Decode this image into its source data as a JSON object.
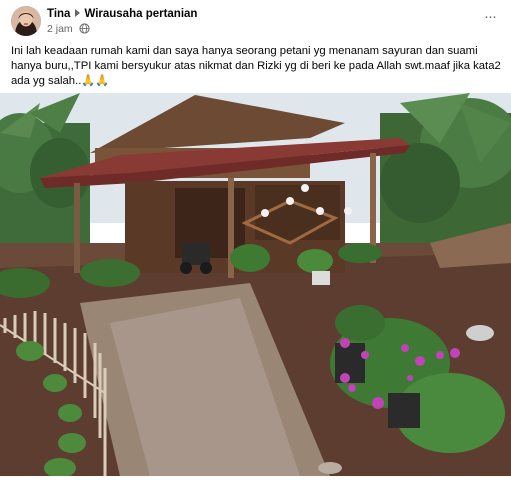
{
  "post": {
    "author": "Tina",
    "group": "Wirausaha pertanian",
    "timestamp": "2 jam",
    "audience_icon": "globe-icon",
    "more_icon": "more-options-icon",
    "more_label": "···",
    "caption_line1": "Ini lah keadaan rumah kami dan saya hanya seorang petani yg menanam sayuran dan suami",
    "caption_line2": "hanya buru,,TPI kami bersyukur atas nikmat dan Rizki yg di beri ke pada Allah swt.maaf jika kata2",
    "caption_line3": "ada yg salah..",
    "caption_emoji": "🙏🙏"
  },
  "colors": {
    "text": "#050505",
    "secondary_text": "#65676b",
    "roof": "#8a3a34",
    "wall": "#5a3a26",
    "flowers": "#c043b8",
    "sky": "#dfe6ec"
  }
}
